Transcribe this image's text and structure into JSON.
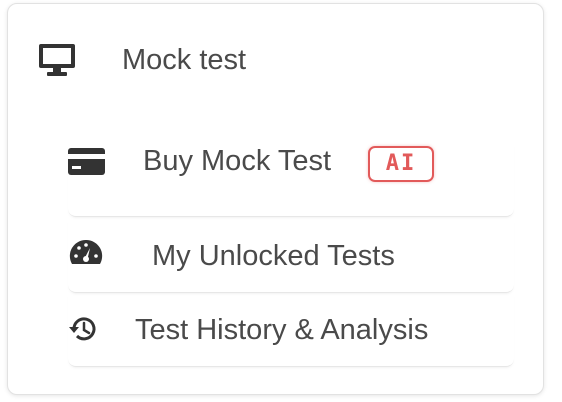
{
  "menu": {
    "header": {
      "title": "Mock test",
      "icon": "monitor-icon"
    },
    "items": [
      {
        "label": "Buy Mock Test",
        "icon": "credit-card-icon",
        "badge": "AI"
      },
      {
        "label": "My Unlocked Tests",
        "icon": "speedometer-icon"
      },
      {
        "label": "Test History & Analysis",
        "icon": "history-icon"
      }
    ]
  },
  "colors": {
    "text": "#4a4a4a",
    "icon": "#333333",
    "badge": "#e25a5a",
    "border": "#e2e2e2"
  }
}
